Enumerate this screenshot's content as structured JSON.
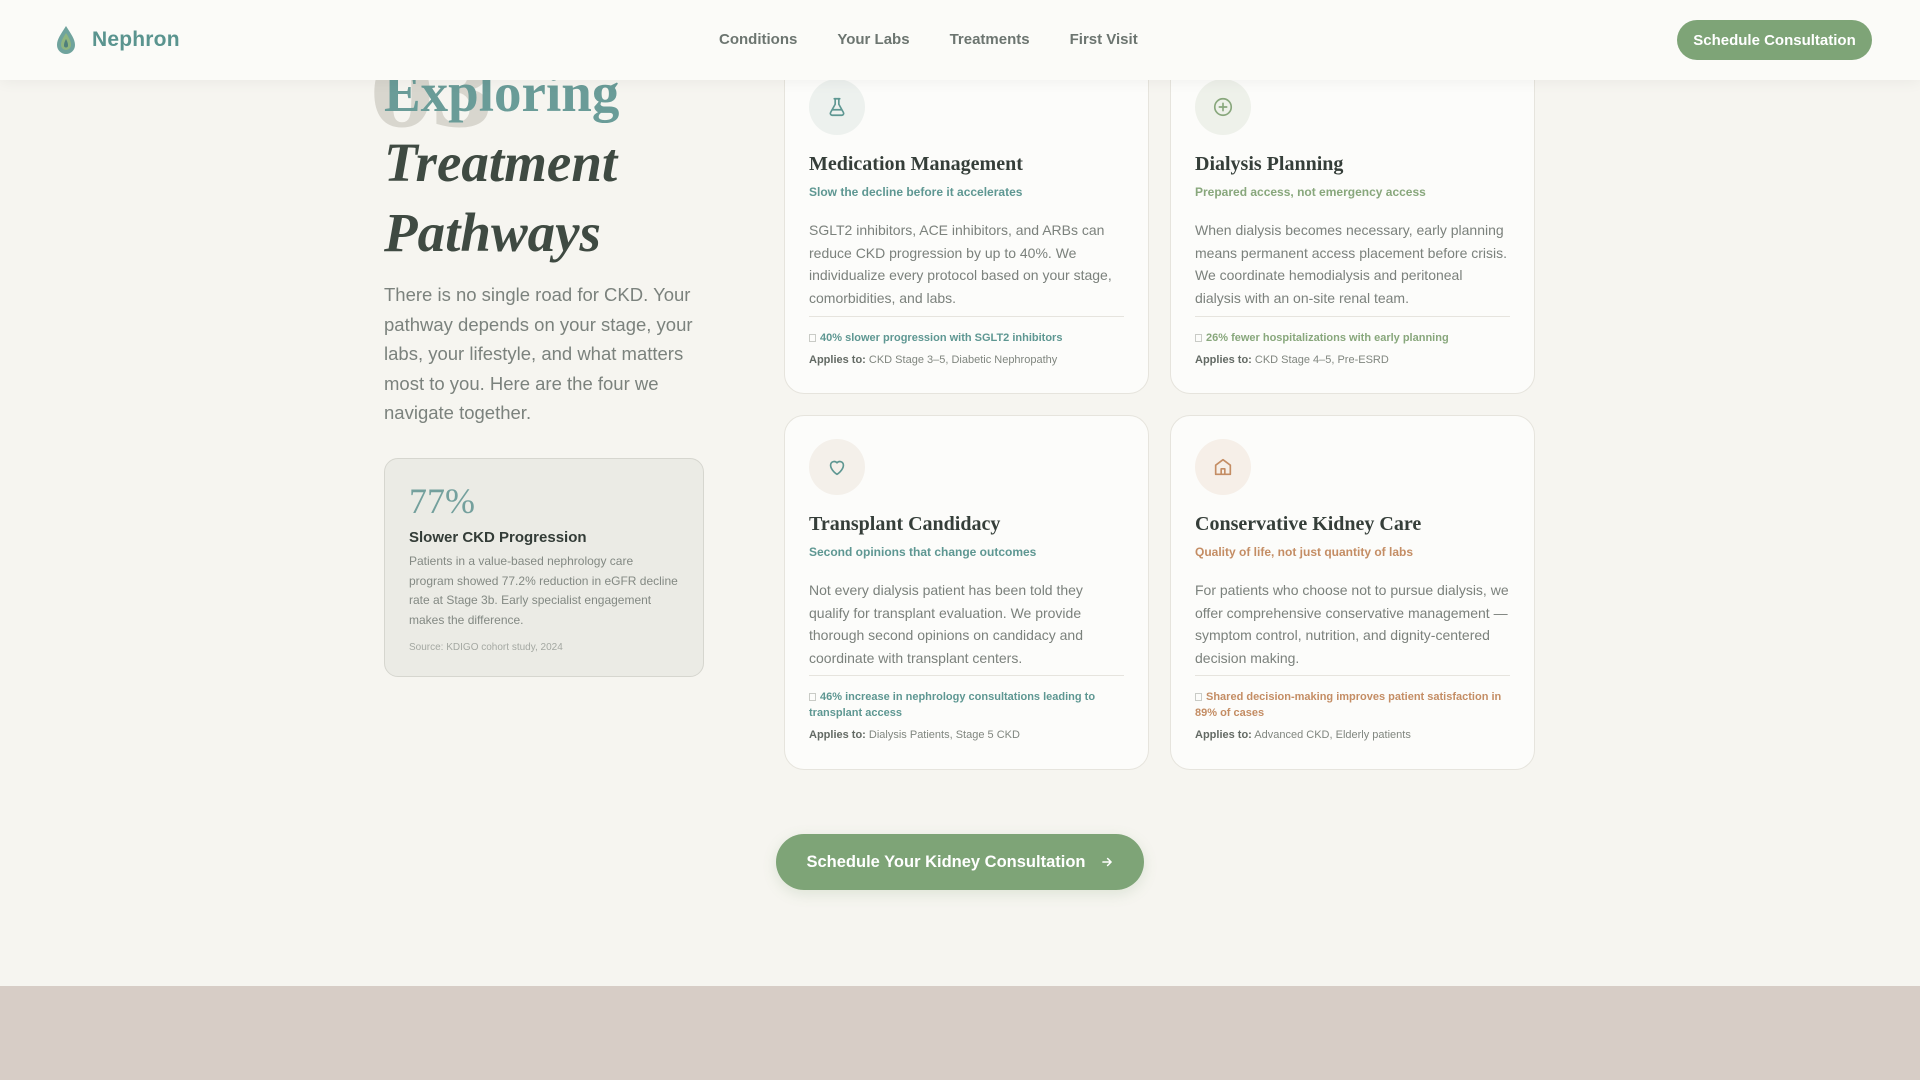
{
  "nav": {
    "brand": "Nephron",
    "links": [
      "Conditions",
      "Your Labs",
      "Treatments",
      "First Visit"
    ],
    "cta": "Schedule Consultation"
  },
  "hero": {
    "section_number": "03",
    "heading_accent": "Exploring",
    "heading_line2": "Treatment",
    "heading_line3": "Pathways",
    "lede": "There is no single road for CKD. Your pathway depends on your stage, your labs, your lifestyle, and what matters most to you. Here are the four we navigate together."
  },
  "stat": {
    "value": "77%",
    "title": "Slower CKD Progression",
    "description": "Patients in a value-based nephrology care program showed 77.2% reduction in eGFR decline rate at Stage 3b. Early specialist engagement makes the difference.",
    "source": "Source: KDIGO cohort study, 2024"
  },
  "cards": [
    {
      "icon": "flask-icon",
      "title": "Medication Management",
      "subtitle": "Slow the decline before it accelerates",
      "body": "SGLT2 inhibitors, ACE inhibitors, and ARBs can reduce CKD progression by up to 40%. We individualize every protocol based on your stage, comorbidities, and labs.",
      "stat": "40% slower progression with SGLT2 inhibitors",
      "applies_label": "Applies to:",
      "applies": "CKD Stage 3–5, Diabetic Nephropathy",
      "accent": "#5e9792"
    },
    {
      "icon": "plus-circle-icon",
      "title": "Dialysis Planning",
      "subtitle": "Prepared access, not emergency access",
      "body": "When dialysis becomes necessary, early planning means permanent access placement before crisis. We coordinate hemodialysis and peritoneal dialysis with an on-site renal team.",
      "stat": "26% fewer hospitalizations with early planning",
      "applies_label": "Applies to:",
      "applies": "CKD Stage 4–5, Pre-ESRD",
      "accent": "#88a77c"
    },
    {
      "icon": "heart-icon",
      "title": "Transplant Candidacy",
      "subtitle": "Second opinions that change outcomes",
      "body": "Not every dialysis patient has been told they qualify for transplant evaluation. We provide thorough second opinions on candidacy and coordinate with transplant centers.",
      "stat": "46% increase in nephrology consultations leading to transplant access",
      "applies_label": "Applies to:",
      "applies": "Dialysis Patients, Stage 5 CKD",
      "accent": "#5e9792"
    },
    {
      "icon": "home-icon",
      "title": "Conservative Kidney Care",
      "subtitle": "Quality of life, not just quantity of labs",
      "body": "For patients who choose not to pursue dialysis, we offer comprehensive conservative management — symptom control, nutrition, and dignity-centered decision making.",
      "stat": "Shared decision-making improves patient satisfaction in 89% of cases",
      "applies_label": "Applies to:",
      "applies": "Advanced CKD, Elderly patients",
      "accent": "#c48d64"
    }
  ],
  "cta": {
    "label": "Schedule Your Kidney Consultation",
    "icon": "arrow-right-icon"
  },
  "colors": {
    "brand": "#5a948f",
    "button": "#7ea477",
    "background": "#f6f5f0",
    "footer": "#d7cdc6"
  }
}
